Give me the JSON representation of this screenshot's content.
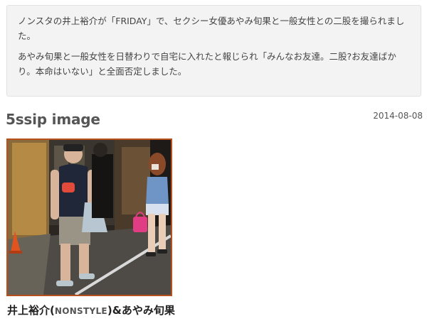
{
  "summary": {
    "paragraph1": "ノンスタの井上裕介が「FRIDAY」で、セクシー女優あやみ旬果と一般女性との二股を撮られました。",
    "paragraph2": "あやみ旬果と一般女性を日替わりで自宅に入れたと報じられ「みんなお友達。二股?お友達ばかり。本命はいない」と全面否定しました。"
  },
  "section": {
    "title": "5ssip image",
    "date": "2014-08-08"
  },
  "caption": {
    "name1": "井上裕介(",
    "group": "NONSTYLE",
    "name2": ")&あやみ旬果"
  },
  "colors": {
    "frame": "#b8501c",
    "box_bg": "#f3f3f3"
  }
}
